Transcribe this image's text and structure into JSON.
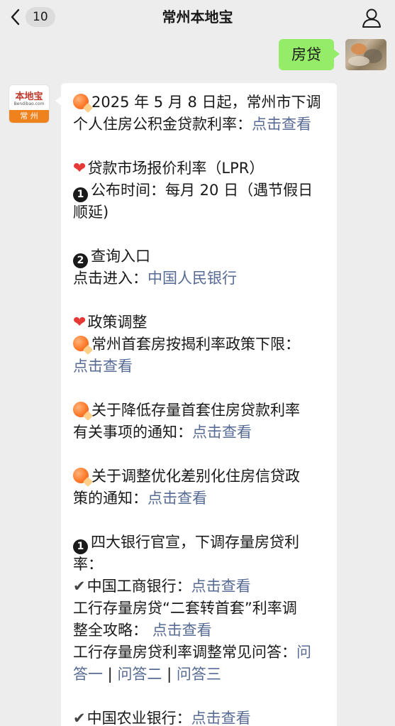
{
  "header": {
    "unread_count": "10",
    "title": "常州本地宝"
  },
  "outgoing": {
    "text": "房贷"
  },
  "account": {
    "logo_text": "本地宝",
    "logo_sub": "Bendibao.com",
    "city": "常 州"
  },
  "message": {
    "lines": [
      {
        "text": "2025 年 5 月 8 日起，常州市下调",
        "icon": "spark"
      },
      {
        "text": "个人住房公积金贷款利率：",
        "link": "点击查看"
      },
      {
        "gap": true
      },
      {
        "text": "贷款市场报价利率（LPR）",
        "icon": "heart"
      },
      {
        "text": "公布时间：每月 20 日（遇节假日",
        "icon": "num",
        "num": "1"
      },
      {
        "text": "顺延)"
      },
      {
        "gap": true
      },
      {
        "text": "查询入口",
        "icon": "num",
        "num": "2"
      },
      {
        "text": "点击进入：",
        "link": "中国人民银行"
      },
      {
        "gap": true
      },
      {
        "text": "政策调整",
        "icon": "heart"
      },
      {
        "text": "常州首套房按揭利率政策下限：",
        "icon": "spark"
      },
      {
        "text": "",
        "link": "点击查看"
      },
      {
        "gap": true
      },
      {
        "text": "关于降低存量首套住房贷款利率",
        "icon": "spark"
      },
      {
        "text": "有关事项的通知：",
        "link": "点击查看"
      },
      {
        "gap": true
      },
      {
        "text": "关于调整优化差别化住房信贷政",
        "icon": "spark"
      },
      {
        "text": "策的通知：",
        "link": "点击查看"
      },
      {
        "gap": true
      },
      {
        "text": "四大银行官宣，下调存量房贷利",
        "icon": "num",
        "num": "1"
      },
      {
        "text": "率："
      },
      {
        "text": "中国工商银行：",
        "icon": "check",
        "link": "点击查看"
      },
      {
        "text": "工行存量房贷“二套转首套”利率调"
      },
      {
        "text": "整全攻略： ",
        "link": "点击查看"
      },
      {
        "text": "工行存量房贷利率调整常见问答：",
        "link": "问"
      },
      {
        "text": "",
        "link_parts": [
          "答一",
          " | ",
          "问答二",
          " | ",
          "问答三"
        ]
      },
      {
        "gap": true
      },
      {
        "text": "中国农业银行：",
        "icon": "check",
        "link": "点击查看"
      }
    ]
  },
  "icons": {
    "back": "chevron-left-icon",
    "profile": "person-icon",
    "spark": "firecracker-icon",
    "heart": "heart-icon",
    "num": "circled-number-icon",
    "check": "check-mark-icon"
  },
  "colors": {
    "background": "#ededed",
    "outgoing_bubble": "#95ec69",
    "link": "#576b95",
    "account_orange": "#f0821e"
  }
}
